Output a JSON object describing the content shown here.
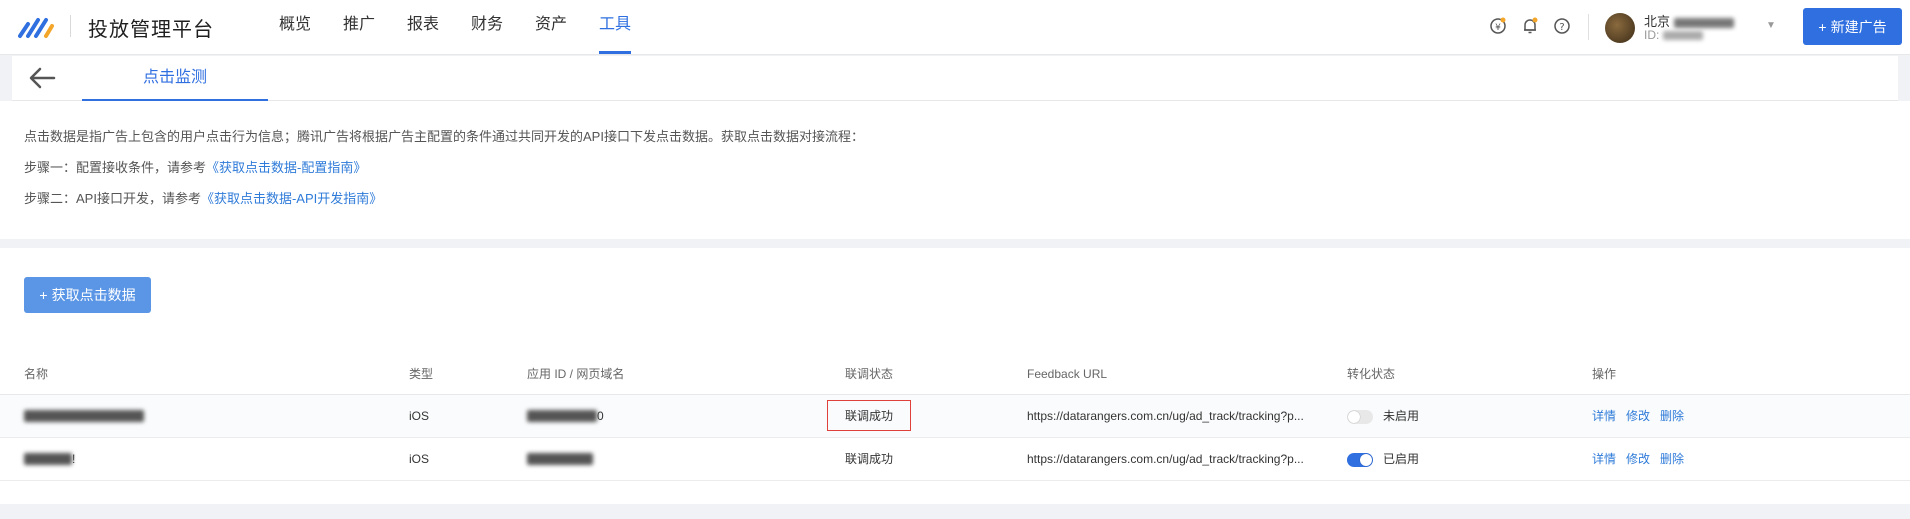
{
  "brand": "投放管理平台",
  "nav": [
    {
      "label": "概览"
    },
    {
      "label": "推广"
    },
    {
      "label": "报表"
    },
    {
      "label": "财务"
    },
    {
      "label": "资产"
    },
    {
      "label": "工具"
    }
  ],
  "nav_active_index": 5,
  "account": {
    "name": "北京",
    "id_label": "ID: "
  },
  "new_ad_button": "新建广告",
  "page_tab": "点击监测",
  "description": {
    "line1": "点击数据是指广告上包含的用户点击行为信息；腾讯广告将根据广告主配置的条件通过共同开发的API接口下发点击数据。获取点击数据对接流程：",
    "step1_text": "步骤一：配置接收条件，请参考",
    "step1_link": "《获取点击数据-配置指南》",
    "step2_text": "步骤二：API接口开发，请参考",
    "step2_link": "《获取点击数据-API开发指南》"
  },
  "get_click_data_button": "获取点击数据",
  "table": {
    "headers": {
      "name": "名称",
      "type": "类型",
      "app": "应用 ID / 网页域名",
      "status": "联调状态",
      "feedback": "Feedback URL",
      "conversion": "转化状态",
      "ops": "操作"
    },
    "rows": [
      {
        "type": "iOS",
        "app_suffix": "0",
        "status": "联调成功",
        "feedback_url": "https://datarangers.com.cn/ug/ad_track/tracking?p...",
        "conversion_status": "未启用",
        "conversion_on": false,
        "ops": [
          "详情",
          "修改",
          "删除"
        ]
      },
      {
        "name_suffix": "!",
        "type": "iOS",
        "status": "联调成功",
        "feedback_url": "https://datarangers.com.cn/ug/ad_track/tracking?p...",
        "conversion_status": "已启用",
        "conversion_on": true,
        "ops": [
          "详情",
          "修改",
          "删除"
        ]
      }
    ]
  },
  "colors": {
    "accent": "#2f6fe0",
    "link": "#2f7bd9",
    "highlight_border": "#e0403a"
  }
}
